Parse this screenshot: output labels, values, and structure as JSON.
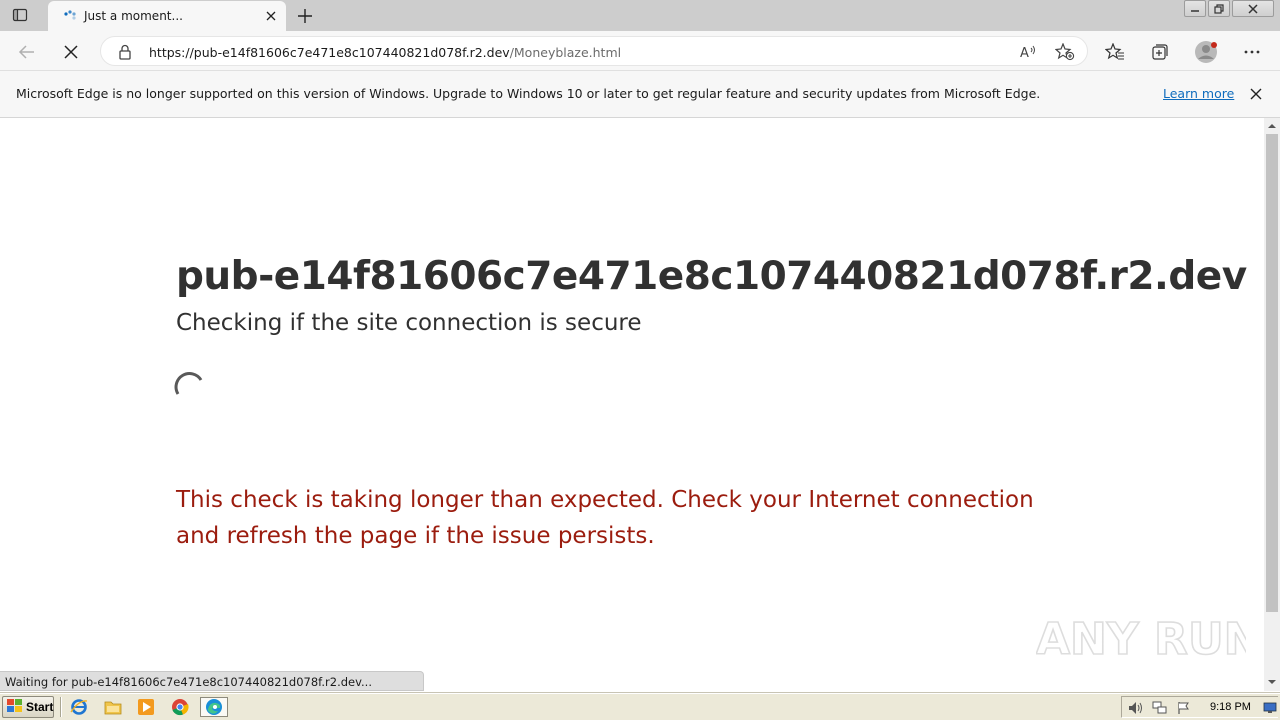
{
  "browser": {
    "tab": {
      "title": "Just a moment..."
    },
    "address": {
      "host": "https://pub-e14f81606c7e471e8c107440821d078f.r2.dev",
      "path": "/Moneyblaze.html"
    },
    "infobar": {
      "message": "Microsoft Edge is no longer supported on this version of Windows. Upgrade to Windows 10 or later to get regular feature and security updates from Microsoft Edge.",
      "link": "Learn more"
    },
    "status_bubble": "Waiting for pub-e14f81606c7e471e8c107440821d078f.r2.dev..."
  },
  "page": {
    "title": "pub-e14f81606c7e471e8c107440821d078f.r2.dev",
    "subtitle": "Checking if the site connection is secure",
    "error": "This check is taking longer than expected. Check your Internet connection and refresh the page if the issue persists."
  },
  "watermark": {
    "text": "ANY RUN"
  },
  "taskbar": {
    "start_label": "Start",
    "clock": "9:18 PM"
  },
  "icons": {
    "tab_actions": "tab-actions-icon",
    "tab_loading": "loading-icon",
    "back": "back-arrow-icon",
    "stop": "stop-icon",
    "lock": "lock-icon",
    "read_aloud": "read-aloud-icon",
    "add_favorite": "add-favorite-icon",
    "favorites": "favorites-icon",
    "collections": "collections-icon",
    "profile": "profile-icon",
    "more": "more-icon"
  },
  "colors": {
    "error_text": "#9b1c0e",
    "link": "#0f6cbd",
    "heading": "#313131"
  }
}
